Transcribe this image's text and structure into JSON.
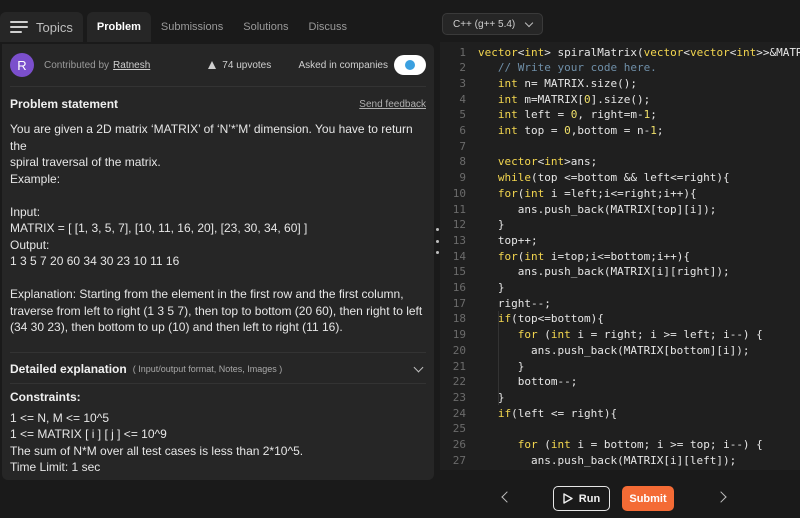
{
  "tabs": {
    "topics": "Topics",
    "problem": "Problem",
    "submissions": "Submissions",
    "solutions": "Solutions",
    "discuss": "Discuss"
  },
  "meta": {
    "avatar_letter": "R",
    "contributed_by": "Contributed by",
    "author": "Ratnesh",
    "upvotes": "74 upvotes",
    "asked_in": "Asked in companies"
  },
  "problem": {
    "heading": "Problem statement",
    "feedback": "Send feedback",
    "lines": [
      "You are given a 2D matrix ‘MATRIX’ of ‘N’*’M’ dimension. You have to return the",
      "spiral traversal of the matrix.",
      "Example:",
      "",
      "Input:",
      "MATRIX = [ [1, 3, 5, 7], [10, 11, 16, 20], [23, 30, 34, 60] ]",
      "Output:",
      "1 3 5 7 20 60 34 30 23 10 11 16",
      "",
      "Explanation: Starting from the element in the first row and the first column,",
      "traverse from left to right (1 3 5 7), then top to bottom (20 60), then right to left",
      "(34 30 23), then bottom to up (10) and then left to right (11 16)."
    ]
  },
  "detailed": {
    "title": "Detailed explanation",
    "sub": "( Input/output format, Notes, Images )"
  },
  "constraints": {
    "heading": "Constraints:",
    "lines": [
      "1 <= N, M <= 10^5",
      "1 <= MATRIX [ i ] [ j ] <= 10^9",
      "The sum of N*M over all test cases is less than 2*10^5.",
      "Time Limit: 1 sec"
    ]
  },
  "editor": {
    "language": "C++ (g++ 5.4)",
    "lines": [
      {
        "n": "1",
        "t": "vector<int> spiralMatrix(vector<vector<int>>&MATRIX)"
      },
      {
        "n": "2",
        "t": "   // Write your code here."
      },
      {
        "n": "3",
        "t": "   int n= MATRIX.size();"
      },
      {
        "n": "4",
        "t": "   int m=MATRIX[0].size();"
      },
      {
        "n": "5",
        "t": "   int left = 0, right=m-1;"
      },
      {
        "n": "6",
        "t": "   int top = 0,bottom = n-1;"
      },
      {
        "n": "7",
        "t": ""
      },
      {
        "n": "8",
        "t": "   vector<int>ans;"
      },
      {
        "n": "9",
        "t": "   while(top <=bottom && left<=right){"
      },
      {
        "n": "10",
        "t": "   for(int i =left;i<=right;i++){"
      },
      {
        "n": "11",
        "t": "      ans.push_back(MATRIX[top][i]);"
      },
      {
        "n": "12",
        "t": "   }"
      },
      {
        "n": "13",
        "t": "   top++;"
      },
      {
        "n": "14",
        "t": "   for(int i=top;i<=bottom;i++){"
      },
      {
        "n": "15",
        "t": "      ans.push_back(MATRIX[i][right]);"
      },
      {
        "n": "16",
        "t": "   }"
      },
      {
        "n": "17",
        "t": "   right--;"
      },
      {
        "n": "18",
        "t": "   if(top<=bottom){"
      },
      {
        "n": "19",
        "t": "      for (int i = right; i >= left; i--) {"
      },
      {
        "n": "20",
        "t": "        ans.push_back(MATRIX[bottom][i]);"
      },
      {
        "n": "21",
        "t": "      }"
      },
      {
        "n": "22",
        "t": "      bottom--;"
      },
      {
        "n": "23",
        "t": "   }"
      },
      {
        "n": "24",
        "t": "   if(left <= right){"
      },
      {
        "n": "25",
        "t": ""
      },
      {
        "n": "26",
        "t": "      for (int i = bottom; i >= top; i--) {"
      },
      {
        "n": "27",
        "t": "        ans.push_back(MATRIX[i][left]);"
      }
    ]
  },
  "actions": {
    "run": "Run",
    "submit": "Submit"
  }
}
